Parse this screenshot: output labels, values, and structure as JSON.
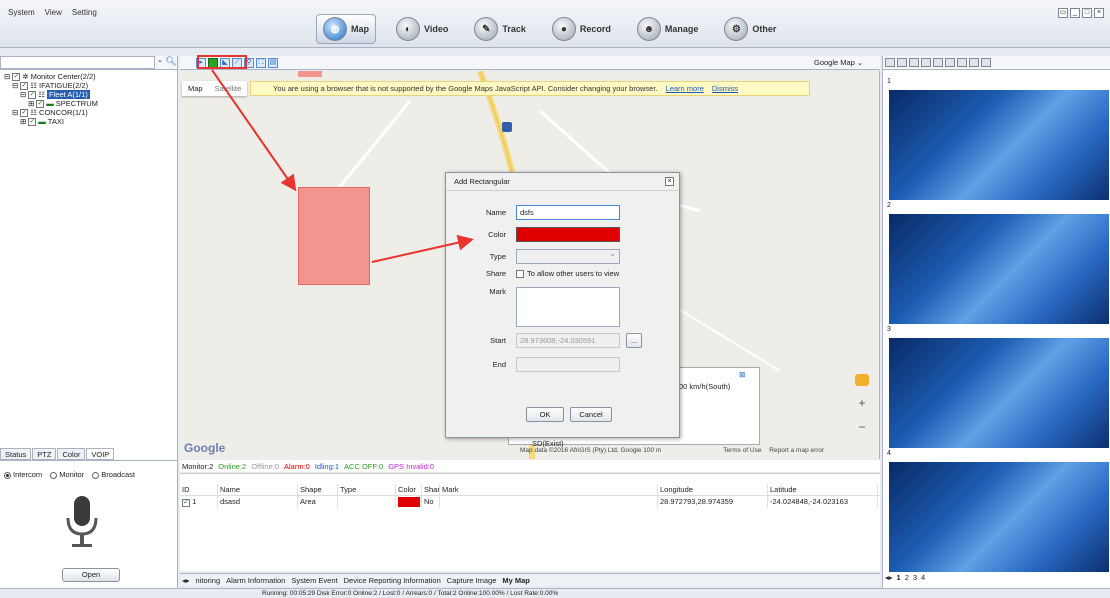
{
  "menu": [
    "System",
    "View",
    "Setting"
  ],
  "modules": [
    {
      "label": "Map",
      "icon": "globe-icon",
      "active": true
    },
    {
      "label": "Video",
      "icon": "camera-icon",
      "active": false
    },
    {
      "label": "Track",
      "icon": "route-icon",
      "active": false
    },
    {
      "label": "Record",
      "icon": "record-icon",
      "active": false
    },
    {
      "label": "Manage",
      "icon": "users-icon",
      "active": false
    },
    {
      "label": "Other",
      "icon": "settings-icon",
      "active": false
    }
  ],
  "tree": {
    "root": "Monitor Center(2/2)",
    "group1": "IFATIGUE(2/2)",
    "fleet": "Fleet A(1/1)",
    "vehicle1": "SPECTRUM",
    "group2": "CONCOR(1/1)",
    "vehicle2": "TAXI"
  },
  "left_tabs": [
    "Status",
    "PTZ",
    "Color",
    "VOIP"
  ],
  "intercom_options": [
    "Intercom",
    "Monitor",
    "Broadcast"
  ],
  "open_label": "Open",
  "map_provider": "Google Map",
  "map_types": [
    "Map",
    "Satellite"
  ],
  "warning": {
    "text": "You are using a browser that is not supported by the Google Maps JavaScript API. Consider changing your browser.",
    "learn_more": "Learn more",
    "dismiss": "Dismiss"
  },
  "google_logo": "Google",
  "info_speed": "00 km/h(South)",
  "info_text": "SD(Exist)",
  "map_footer": "Map data ©2016 AfriGIS (Pty) Ltd, Google   100 m",
  "terms": "Terms of Use",
  "report": "Report a map error",
  "dialog": {
    "title": "Add Rectangular",
    "name_label": "Name",
    "name_value": "dsfs",
    "color_label": "Color",
    "type_label": "Type",
    "share_label": "Share",
    "share_text": "To allow other users to view",
    "mark_label": "Mark",
    "start_label": "Start",
    "start_value": "28.973608,-24.030591",
    "end_label": "End",
    "browse": "...",
    "ok": "OK",
    "cancel": "Cancel"
  },
  "status_counts": {
    "monitor": "Monitor:2",
    "online": "Online:2",
    "offline": "Offline:0",
    "alarm": "Alarm:0",
    "idling": "Idling:1",
    "acc": "ACC OFF:0",
    "gps": "GPS Invalid:0"
  },
  "table": {
    "headers": [
      "ID",
      "Name",
      "Shape",
      "Type",
      "Color",
      "Share",
      "Mark",
      "Longitude",
      "Latitude"
    ],
    "row": {
      "id": "1",
      "name": "dsasd",
      "shape": "Area",
      "type": "",
      "share": "No",
      "mark": "",
      "longitude": "28.972793,28.974359",
      "latitude": "-24.024848,-24.023163"
    }
  },
  "bottom_tabs": [
    "nitoring",
    "Alarm Information",
    "System Event",
    "Device Reporting Information",
    "Capture Image",
    "My Map"
  ],
  "status_bar": "Running: 00:05:29   Disk Error:0   Online:2 / Lost:0 / Arrears:0 / Total:2   Online:100.00% / Lost Rate:0.00%",
  "video_cells": [
    "1",
    "2",
    "3",
    "4"
  ],
  "video_tabs": [
    "1",
    "2",
    "3",
    "4"
  ],
  "colors": {
    "accent": "#1e6cc4",
    "highlight": "#e8332e",
    "area": "#f4948e"
  }
}
